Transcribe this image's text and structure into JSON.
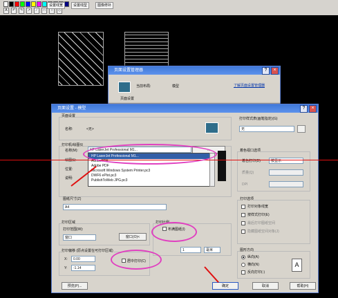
{
  "toolbar": {
    "colors": [
      "#ffffff",
      "#000000",
      "#ff0000",
      "#00ff00",
      "#0000ff",
      "#ffff00",
      "#ff00ff",
      "#00ffff",
      "#808080",
      "#800000",
      "#008000",
      "#000080"
    ],
    "tabs": [
      "设置线宽",
      "设置线型",
      "图像修补"
    ],
    "tools": [
      "A",
      "↶",
      "↷",
      "↗",
      "∕",
      "□",
      "○",
      "◇"
    ]
  },
  "back_dialog": {
    "title": "页面设置管理器",
    "current_layout_label": "当前布局:",
    "current_layout_value": "模型",
    "page_setup_label": "页面设置",
    "link": "了解页面设置管理器"
  },
  "dialog": {
    "title": "页面设置 - 模型",
    "page_setup_section": "页面设置",
    "name_label": "名称:",
    "name_value": "<无>",
    "printer_section": "打印机/绘图仪",
    "printer_name_label": "名称(M):",
    "plotter_label": "绘图仪:",
    "location_label": "位置:",
    "description_label": "说明:",
    "printer_options": [
      "HP LaserJet Professional M1...",
      "AdobePDF",
      "Adobe PDF",
      "Microsoft Windows System Printer.pc3",
      "DWF6 ePlot.pc3",
      "PublishToWeb JPG.pc3"
    ],
    "printer_selected": "HP LaserJet Professional M1...",
    "paper_size_label": "图纸尺寸(Z)",
    "paper_size_value": "A4",
    "plot_area_section": "打印区域",
    "plot_range_label": "打印范围(W):",
    "plot_range_value": "窗口",
    "window_button": "窗口(O)<",
    "plot_scale_section": "打印比例",
    "fit_paper_label": "布满图纸(I)",
    "scale_value": "1",
    "scale_unit": "毫米",
    "offset_section": "打印偏移 (原点设置在可打印区域)",
    "x_label": "X:",
    "x_value": "0.00",
    "y_label": "Y:",
    "y_value": "-1.14",
    "center_plot_label": "居中打印(C)",
    "plot_style_section": "打印样式表(画笔指定)(G)",
    "plot_style_value": "无",
    "shaded_viewport_section": "着色视口选项",
    "shade_plot_label": "着色打印(D)",
    "shade_plot_value": "按显示",
    "quality_label": "质量(Q)",
    "dpi_label": "DPI",
    "plot_options_section": "打印选项",
    "plot_options": [
      {
        "label": "打印对象线宽",
        "checked": true
      },
      {
        "label": "按样式打印(E)",
        "checked": false
      },
      {
        "label": "最后打印图纸空间",
        "checked": false
      },
      {
        "label": "隐藏图纸空间对象(J)",
        "checked": false
      }
    ],
    "orientation_section": "图形方向",
    "orientation_options": [
      {
        "label": "纵向(A)",
        "selected": true
      },
      {
        "label": "横向(N)",
        "selected": false
      },
      {
        "label": "反向打印(-)",
        "selected": false
      }
    ],
    "preview_button": "预览(P)...",
    "ok_button": "确定",
    "cancel_button": "取消",
    "help_button": "帮助(H)"
  },
  "annotation_color": "#e040c0"
}
